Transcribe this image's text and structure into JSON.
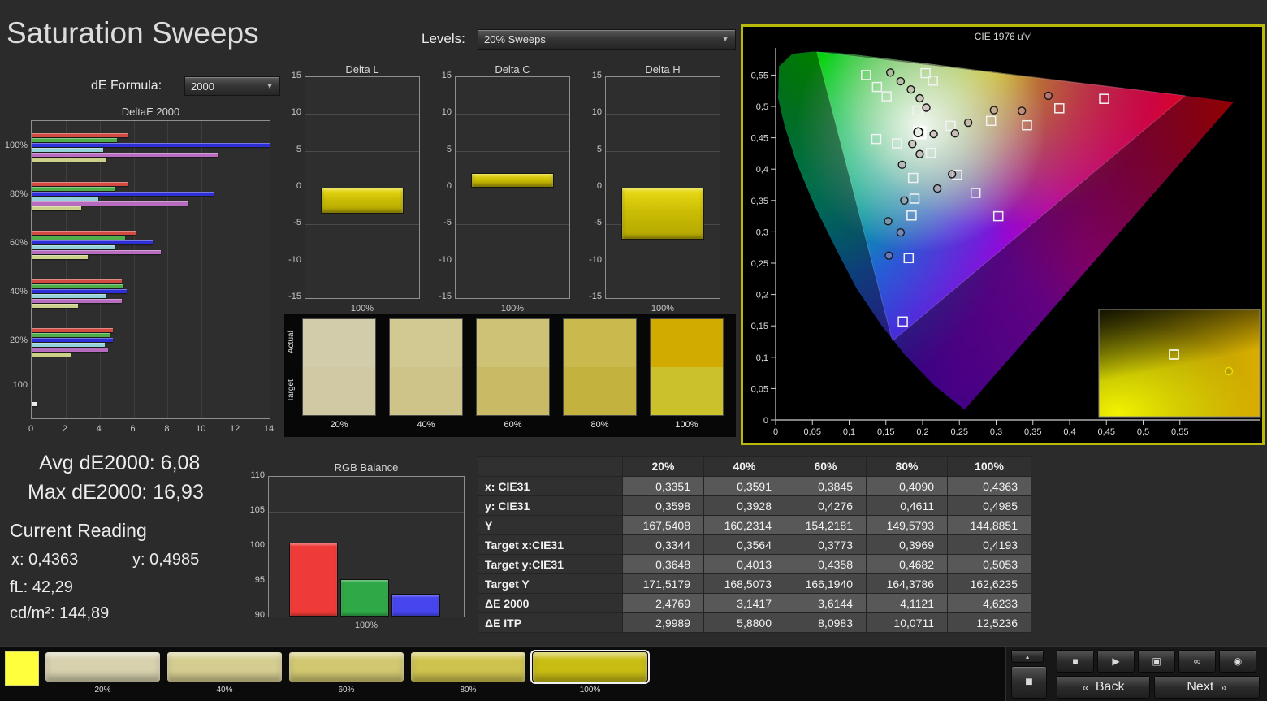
{
  "page": {
    "title": "Saturation Sweeps"
  },
  "toolbar_top": {
    "levels_label": "Levels:",
    "levels_value": "20% Sweeps",
    "de_formula_label": "dE Formula:",
    "de_formula_value": "2000"
  },
  "stats": {
    "avg_label": "Avg dE2000:",
    "avg_value": "6,08",
    "max_label": "Max dE2000:",
    "max_value": "16,93",
    "current_heading": "Current Reading",
    "x_label": "x:",
    "x_value": "0,4363",
    "y_label": "y:",
    "y_value": "0,4985",
    "fl_label": "fL:",
    "fl_value": "42,29",
    "cd_label": "cd/m²:",
    "cd_value": "144,89"
  },
  "chart_data": [
    {
      "id": "deltaE2000",
      "type": "bar",
      "orientation": "horizontal",
      "title": "DeltaE 2000",
      "xlim": [
        0,
        14
      ],
      "x_ticks": [
        0,
        2,
        4,
        6,
        8,
        10,
        12,
        14
      ],
      "group_labels": [
        "100%",
        "80%",
        "60%",
        "40%",
        "20%",
        "100"
      ],
      "series": [
        {
          "name": "Red",
          "color": "#d24a42",
          "values": [
            5.7,
            5.7,
            6.1,
            5.3,
            4.8,
            null
          ]
        },
        {
          "name": "Green",
          "color": "#4fae4a",
          "values": [
            5.0,
            4.9,
            5.5,
            5.4,
            4.6,
            null
          ]
        },
        {
          "name": "Blue",
          "color": "#2f2fd8",
          "values": [
            14.7,
            10.7,
            7.1,
            5.6,
            4.8,
            null
          ]
        },
        {
          "name": "Cyan",
          "color": "#93d2d8",
          "values": [
            4.2,
            3.9,
            4.9,
            4.4,
            4.3,
            null
          ]
        },
        {
          "name": "Magenta",
          "color": "#b86cc0",
          "values": [
            11.0,
            9.2,
            7.6,
            5.3,
            4.5,
            null
          ]
        },
        {
          "name": "Yellow",
          "color": "#cdd089",
          "values": [
            4.4,
            2.9,
            3.3,
            2.7,
            2.3,
            null
          ]
        },
        {
          "name": "White",
          "color": "#ececec",
          "values": [
            null,
            null,
            null,
            null,
            null,
            0.35
          ]
        }
      ]
    },
    {
      "id": "deltaL",
      "type": "bar",
      "title": "Delta L",
      "ylim": [
        -15,
        15
      ],
      "y_ticks": [
        15,
        10,
        5,
        0,
        -5,
        -10,
        -15
      ],
      "categories": [
        "100%"
      ],
      "values": [
        -3.5
      ],
      "bar_color": "#d8ca08"
    },
    {
      "id": "deltaC",
      "type": "bar",
      "title": "Delta C",
      "ylim": [
        -15,
        15
      ],
      "y_ticks": [
        15,
        10,
        5,
        0,
        -5,
        -10,
        -15
      ],
      "categories": [
        "100%"
      ],
      "values": [
        2.0
      ],
      "bar_color": "#d8ca08"
    },
    {
      "id": "deltaH",
      "type": "bar",
      "title": "Delta H",
      "ylim": [
        -15,
        15
      ],
      "y_ticks": [
        15,
        10,
        5,
        0,
        -5,
        -10,
        -15
      ],
      "categories": [
        "100%"
      ],
      "values": [
        -7.0
      ],
      "bar_color": "#d8ca08"
    },
    {
      "id": "rgbBalance",
      "type": "bar",
      "title": "RGB Balance",
      "ylim": [
        90,
        110
      ],
      "y_ticks": [
        110,
        105,
        100,
        95,
        90
      ],
      "categories": [
        "100%"
      ],
      "series": [
        {
          "name": "Red",
          "color": "#ef3b37",
          "value": 100.6
        },
        {
          "name": "Green",
          "color": "#2fa848",
          "value": 95.3
        },
        {
          "name": "Blue",
          "color": "#4745ee",
          "value": 93.3
        }
      ]
    },
    {
      "id": "cie",
      "type": "scatter",
      "title": "CIE 1976 u'v'",
      "x_range": [
        0,
        0.62
      ],
      "y_range": [
        0,
        0.59
      ],
      "x_tick_labels": [
        "0",
        "0,05",
        "0,1",
        "0,15",
        "0,2",
        "0,25",
        "0,3",
        "0,35",
        "0,4",
        "0,45",
        "0,5",
        "0,55"
      ],
      "y_tick_labels": [
        "0",
        "0,05",
        "0,1",
        "0,15",
        "0,2",
        "0,25",
        "0,3",
        "0,35",
        "0,4",
        "0,45",
        "0,5",
        "0,55"
      ],
      "targets": [
        [
          0.123,
          0.55
        ],
        [
          0.138,
          0.531
        ],
        [
          0.151,
          0.516
        ],
        [
          0.193,
          0.493
        ],
        [
          0.204,
          0.553
        ],
        [
          0.214,
          0.541
        ],
        [
          0.447,
          0.512
        ],
        [
          0.386,
          0.497
        ],
        [
          0.342,
          0.47
        ],
        [
          0.293,
          0.477
        ],
        [
          0.238,
          0.469
        ],
        [
          0.137,
          0.448
        ],
        [
          0.165,
          0.441
        ],
        [
          0.211,
          0.426
        ],
        [
          0.187,
          0.386
        ],
        [
          0.247,
          0.391
        ],
        [
          0.189,
          0.353
        ],
        [
          0.272,
          0.362
        ],
        [
          0.303,
          0.325
        ],
        [
          0.185,
          0.326
        ],
        [
          0.181,
          0.258
        ],
        [
          0.173,
          0.157
        ]
      ],
      "measurements": [
        [
          0.156,
          0.554
        ],
        [
          0.17,
          0.54
        ],
        [
          0.184,
          0.527
        ],
        [
          0.196,
          0.513
        ],
        [
          0.205,
          0.498
        ],
        [
          0.371,
          0.517
        ],
        [
          0.335,
          0.493
        ],
        [
          0.297,
          0.494
        ],
        [
          0.262,
          0.474
        ],
        [
          0.244,
          0.457
        ],
        [
          0.215,
          0.456
        ],
        [
          0.186,
          0.44
        ],
        [
          0.196,
          0.424
        ],
        [
          0.172,
          0.407
        ],
        [
          0.24,
          0.392
        ],
        [
          0.22,
          0.369
        ],
        [
          0.175,
          0.35
        ],
        [
          0.153,
          0.317
        ],
        [
          0.17,
          0.299
        ],
        [
          0.154,
          0.262
        ]
      ],
      "current_target": [
        0.196,
        0.458
      ],
      "current_measurement": [
        0.194,
        0.459
      ]
    }
  ],
  "swatch_strip": {
    "actual_label": "Actual",
    "target_label": "Target",
    "levels": [
      {
        "label": "20%",
        "actual": "#d2ccab",
        "target": "#d0c9a3"
      },
      {
        "label": "40%",
        "actual": "#d1c892",
        "target": "#cec489"
      },
      {
        "label": "60%",
        "actual": "#cec274",
        "target": "#c9bb66"
      },
      {
        "label": "80%",
        "actual": "#caba4d",
        "target": "#c4b23e"
      },
      {
        "label": "100%",
        "actual": "#d2ab00",
        "target": "#cbc12b"
      }
    ]
  },
  "table": {
    "col_headers": [
      "20%",
      "40%",
      "60%",
      "80%",
      "100%"
    ],
    "rows": [
      {
        "label": "x: CIE31",
        "values": [
          "0,3351",
          "0,3591",
          "0,3845",
          "0,4090",
          "0,4363"
        ]
      },
      {
        "label": "y: CIE31",
        "values": [
          "0,3598",
          "0,3928",
          "0,4276",
          "0,4611",
          "0,4985"
        ]
      },
      {
        "label": "Y",
        "values": [
          "167,5408",
          "160,2314",
          "154,2181",
          "149,5793",
          "144,8851"
        ]
      },
      {
        "label": "Target x:CIE31",
        "values": [
          "0,3344",
          "0,3564",
          "0,3773",
          "0,3969",
          "0,4193"
        ]
      },
      {
        "label": "Target y:CIE31",
        "values": [
          "0,3648",
          "0,4013",
          "0,4358",
          "0,4682",
          "0,5053"
        ]
      },
      {
        "label": "Target Y",
        "values": [
          "171,5179",
          "168,5073",
          "166,1940",
          "164,3786",
          "162,6235"
        ]
      },
      {
        "label": "ΔE 2000",
        "values": [
          "2,4769",
          "3,1417",
          "3,6144",
          "4,1121",
          "4,6233"
        ]
      },
      {
        "label": "ΔE ITP",
        "values": [
          "2,9989",
          "5,8800",
          "8,0983",
          "10,0711",
          "12,5236"
        ]
      }
    ]
  },
  "bottom_bar": {
    "patch_color": "#ffff3e",
    "swatches": [
      {
        "label": "20%",
        "color": "#d7d1ae",
        "selected": false
      },
      {
        "label": "40%",
        "color": "#d5cd90",
        "selected": false
      },
      {
        "label": "60%",
        "color": "#d2c871",
        "selected": false
      },
      {
        "label": "80%",
        "color": "#cfc34f",
        "selected": false
      },
      {
        "label": "100%",
        "color": "#c9bd14",
        "selected": true
      }
    ],
    "transport": [
      {
        "name": "stop",
        "glyph": "■"
      },
      {
        "name": "play",
        "glyph": "▶"
      },
      {
        "name": "meter",
        "glyph": "▣"
      },
      {
        "name": "loop",
        "glyph": "∞"
      },
      {
        "name": "record",
        "glyph": "◉"
      }
    ],
    "eject_glyph": "▴",
    "square_glyph": "■",
    "back_glyph": "«",
    "back_label": "Back",
    "next_label": "Next",
    "next_glyph": "»"
  }
}
